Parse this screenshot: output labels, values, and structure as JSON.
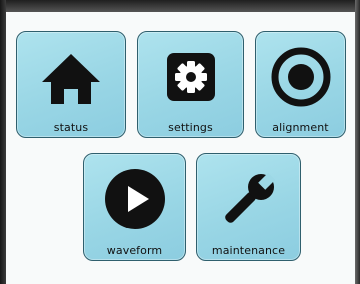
{
  "menu": {
    "tiles": [
      {
        "id": "status",
        "label": "status",
        "icon": "home-icon"
      },
      {
        "id": "settings",
        "label": "settings",
        "icon": "gear-icon"
      },
      {
        "id": "alignment",
        "label": "alignment",
        "icon": "target-icon"
      },
      {
        "id": "waveform",
        "label": "waveform",
        "icon": "play-icon"
      },
      {
        "id": "maintenance",
        "label": "maintenance",
        "icon": "wrench-icon"
      }
    ]
  },
  "colors": {
    "tile_fill": "#9dd8e6",
    "tile_border": "#2f5f6d",
    "icon": "#111111",
    "screen_background": "#f8fafa"
  }
}
